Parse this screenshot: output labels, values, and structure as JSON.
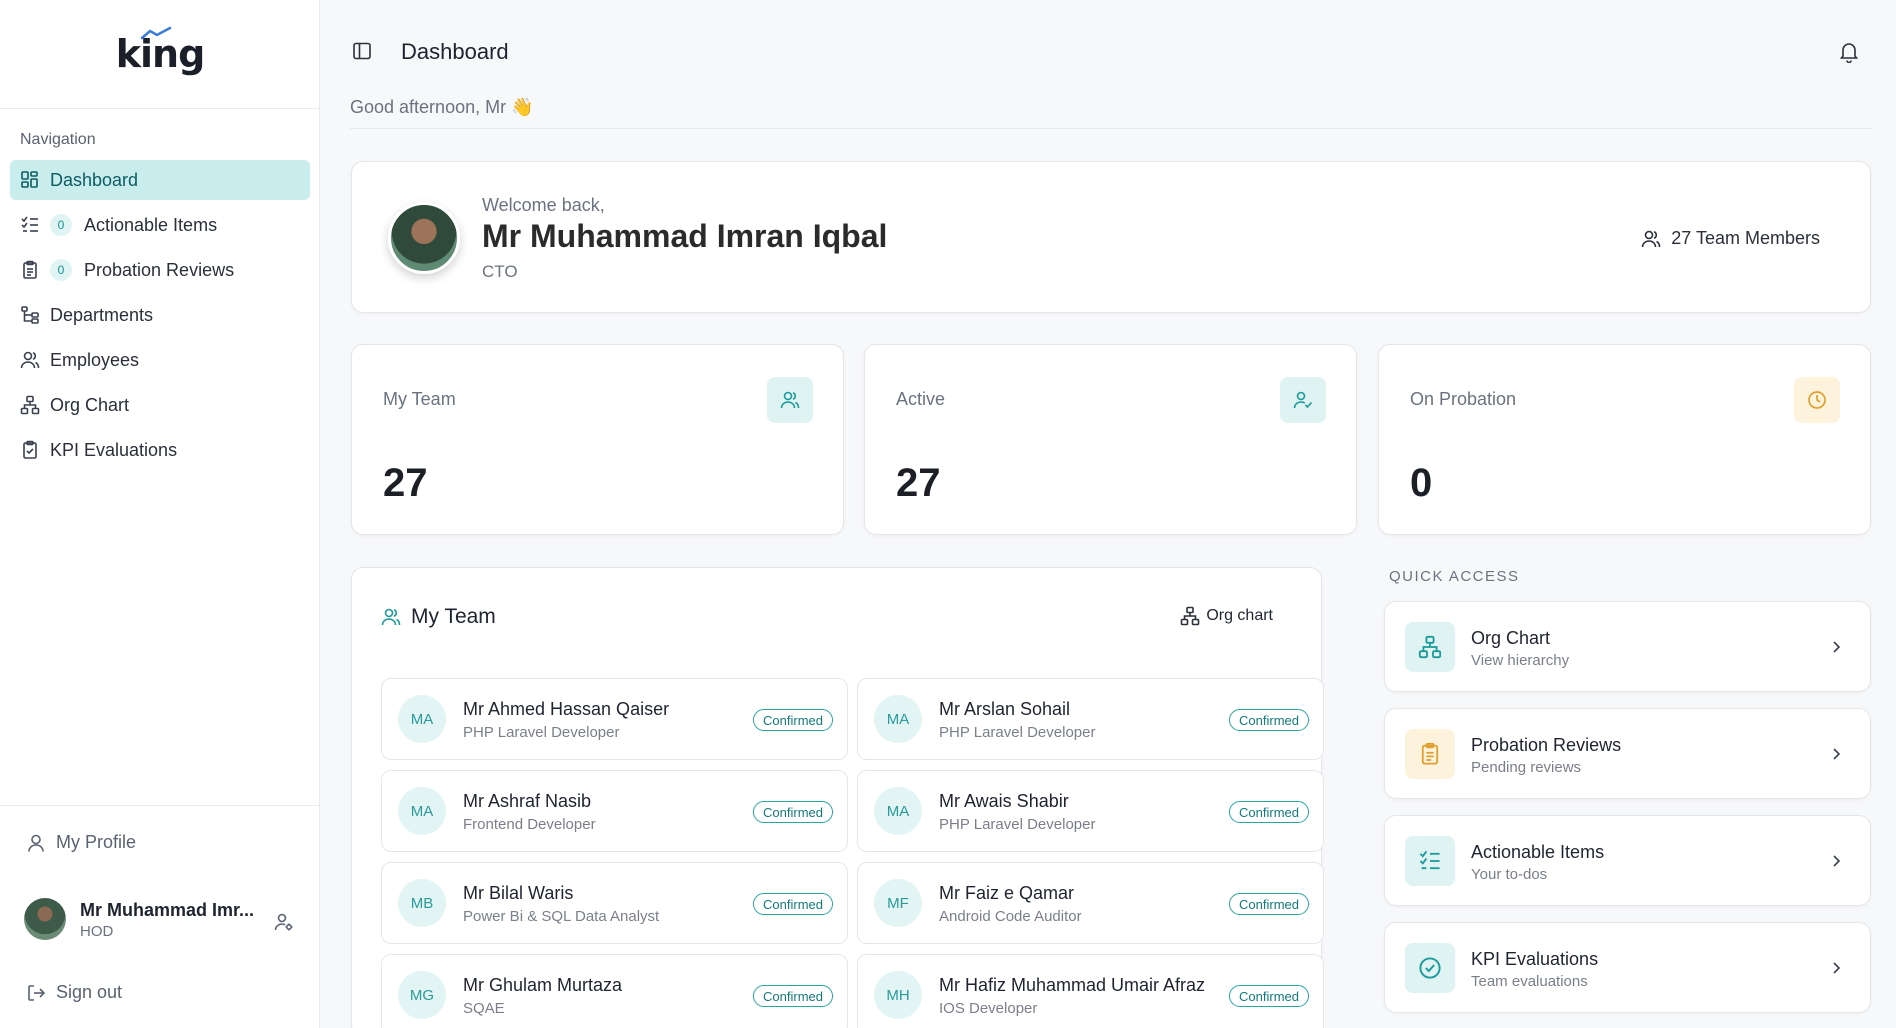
{
  "brand": {
    "logo_text": "king"
  },
  "sidebar": {
    "heading": "Navigation",
    "items": [
      {
        "label": "Dashboard",
        "icon": "grid-icon",
        "active": true
      },
      {
        "label": "Actionable Items",
        "icon": "checklist-icon",
        "badge": "0"
      },
      {
        "label": "Probation Reviews",
        "icon": "clipboard-icon",
        "badge": "0"
      },
      {
        "label": "Departments",
        "icon": "hierarchy-icon"
      },
      {
        "label": "Employees",
        "icon": "users-icon"
      },
      {
        "label": "Org Chart",
        "icon": "network-icon"
      },
      {
        "label": "KPI Evaluations",
        "icon": "clipboard-check-icon"
      }
    ],
    "profile_label": "My Profile",
    "user": {
      "name": "Mr Muhammad Imr...",
      "role": "HOD"
    },
    "signout_label": "Sign out"
  },
  "header": {
    "title": "Dashboard",
    "greeting": "Good afternoon, Mr 👋"
  },
  "welcome": {
    "subtitle": "Welcome back,",
    "name": "Mr Muhammad Imran Iqbal",
    "role": "CTO",
    "team_count": "27 Team Members"
  },
  "stats": [
    {
      "label": "My Team",
      "value": "27",
      "icon": "users-icon",
      "tone": "teal"
    },
    {
      "label": "Active",
      "value": "27",
      "icon": "user-check-icon",
      "tone": "teal"
    },
    {
      "label": "On Probation",
      "value": "0",
      "icon": "clock-icon",
      "tone": "amber"
    }
  ],
  "team": {
    "title": "My Team",
    "org_chart_label": "Org chart",
    "members": [
      {
        "initials": "MA",
        "name": "Mr Ahmed Hassan Qaiser",
        "title": "PHP Laravel Developer",
        "status": "Confirmed"
      },
      {
        "initials": "MA",
        "name": "Mr Arslan Sohail",
        "title": "PHP Laravel Developer",
        "status": "Confirmed"
      },
      {
        "initials": "MA",
        "name": "Mr Ashraf Nasib",
        "title": "Frontend Developer",
        "status": "Confirmed"
      },
      {
        "initials": "MA",
        "name": "Mr Awais Shabir",
        "title": "PHP Laravel Developer",
        "status": "Confirmed"
      },
      {
        "initials": "MB",
        "name": "Mr Bilal Waris",
        "title": "Power Bi & SQL Data Analyst",
        "status": "Confirmed"
      },
      {
        "initials": "MF",
        "name": "Mr Faiz e Qamar",
        "title": "Android Code Auditor",
        "status": "Confirmed"
      },
      {
        "initials": "MG",
        "name": "Mr Ghulam Murtaza",
        "title": "SQAE",
        "status": "Confirmed"
      },
      {
        "initials": "MH",
        "name": "Mr Hafiz Muhammad Umair Afraz",
        "title": "IOS Developer",
        "status": "Confirmed"
      }
    ]
  },
  "quick_access": {
    "heading": "QUICK ACCESS",
    "items": [
      {
        "title": "Org Chart",
        "subtitle": "View hierarchy",
        "icon": "network-icon",
        "tone": "teal"
      },
      {
        "title": "Probation Reviews",
        "subtitle": "Pending reviews",
        "icon": "clipboard-icon",
        "tone": "amber"
      },
      {
        "title": "Actionable Items",
        "subtitle": "Your to-dos",
        "icon": "checklist-icon",
        "tone": "teal"
      },
      {
        "title": "KPI Evaluations",
        "subtitle": "Team evaluations",
        "icon": "check-circle-icon",
        "tone": "teal"
      }
    ]
  },
  "colors": {
    "accent": "#1a9a9a",
    "active_bg": "#c9ecec",
    "amber": "#e0a030"
  }
}
